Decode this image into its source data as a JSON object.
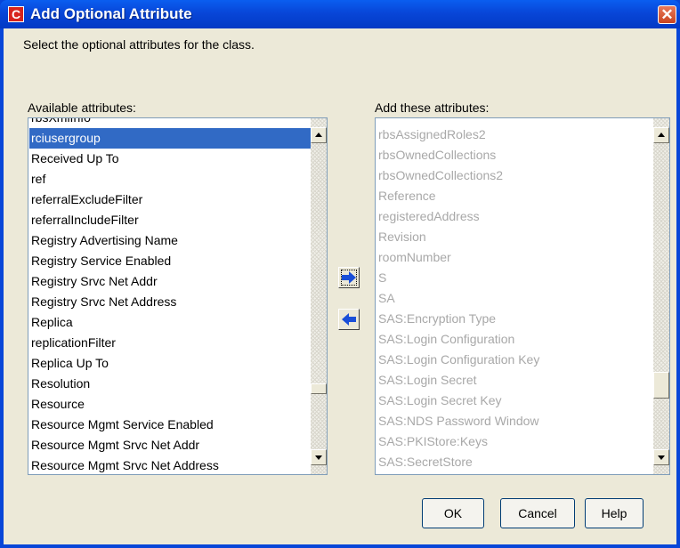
{
  "window": {
    "title": "Add Optional Attribute",
    "close_glyph": "✕",
    "app_icon_glyph": "C"
  },
  "instruction": "Select the optional attributes for the class.",
  "available": {
    "label": "Available attributes:",
    "partial_top": "rbsXmlInfo",
    "selected": "rciusergroup",
    "items": [
      "rciusergroup",
      "Received Up To",
      "ref",
      "referralExcludeFilter",
      "referralIncludeFilter",
      "Registry Advertising Name",
      "Registry Service Enabled",
      "Registry Srvc Net Addr",
      "Registry Srvc Net Address",
      "Replica",
      "replicationFilter",
      "Replica Up To",
      "Resolution",
      "Resource",
      "Resource Mgmt Service Enabled",
      "Resource Mgmt Srvc Net Addr",
      "Resource Mgmt Srvc Net Address"
    ]
  },
  "selected_attrs": {
    "label": "Add these attributes:",
    "items": [
      "rbsAssignedRoles2",
      "rbsOwnedCollections",
      "rbsOwnedCollections2",
      "Reference",
      "registeredAddress",
      "Revision",
      "roomNumber",
      "S",
      "SA",
      "SAS:Encryption Type",
      "SAS:Login Configuration",
      "SAS:Login Configuration Key",
      "SAS:Login Secret",
      "SAS:Login Secret Key",
      "SAS:NDS Password Window",
      "SAS:PKIStore:Keys",
      "SAS:SecretStore"
    ]
  },
  "icons": {
    "add": "arrow-right-icon",
    "remove": "arrow-left-icon",
    "close": "close-icon",
    "app": "app-icon"
  },
  "colors": {
    "selection": "#316ac5",
    "titlebar": "#0846d8",
    "arrow": "#1a4fd8",
    "disabled_text": "#a8a8a8"
  },
  "buttons": {
    "ok": "OK",
    "cancel": "Cancel",
    "help": "Help"
  }
}
